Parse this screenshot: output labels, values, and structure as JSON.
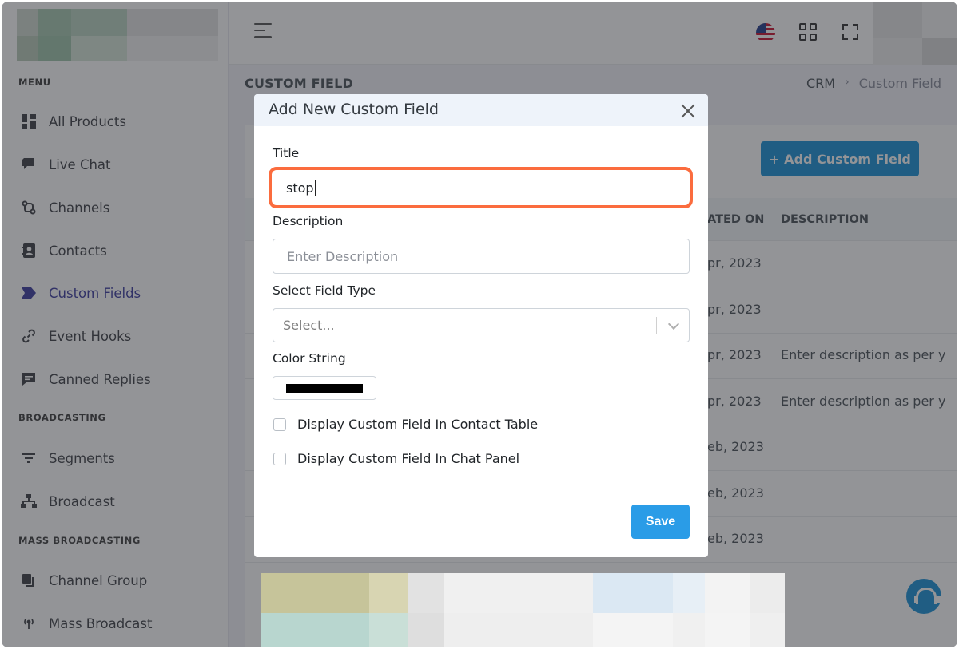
{
  "sidebar": {
    "headings": [
      "MENU",
      "BROADCASTING",
      "MASS BROADCASTING"
    ],
    "items": [
      {
        "label": "All Products",
        "icon": "dashboard-icon"
      },
      {
        "label": "Live Chat",
        "icon": "chat-icon"
      },
      {
        "label": "Channels",
        "icon": "channels-icon"
      },
      {
        "label": "Contacts",
        "icon": "contacts-icon"
      },
      {
        "label": "Custom Fields",
        "icon": "tag-icon"
      },
      {
        "label": "Event Hooks",
        "icon": "link-icon"
      },
      {
        "label": "Canned Replies",
        "icon": "message-icon"
      },
      {
        "label": "Segments",
        "icon": "filter-icon"
      },
      {
        "label": "Broadcast",
        "icon": "broadcast-icon"
      },
      {
        "label": "Channel Group",
        "icon": "copy-icon"
      },
      {
        "label": "Mass Broadcast",
        "icon": "antenna-icon"
      }
    ],
    "active_item": "Custom Fields"
  },
  "page": {
    "title": "CUSTOM FIELD",
    "breadcrumb": [
      "CRM",
      "Custom Field"
    ],
    "add_button": "+ Add Custom Field"
  },
  "table": {
    "headers": [
      "ATED ON",
      "DESCRIPTION"
    ],
    "rows": [
      {
        "created": "pr, 2023",
        "description": ""
      },
      {
        "created": "pr, 2023",
        "description": ""
      },
      {
        "created": "pr, 2023",
        "description": "Enter description as per y"
      },
      {
        "created": "pr, 2023",
        "description": "Enter description as per y"
      },
      {
        "created": "eb, 2023",
        "description": ""
      },
      {
        "created": "eb, 2023",
        "description": ""
      },
      {
        "created": "eb, 2023",
        "description": ""
      }
    ]
  },
  "modal": {
    "title": "Add New Custom Field",
    "title_label": "Title",
    "title_value": "stop",
    "description_label": "Description",
    "description_placeholder": "Enter Description",
    "field_type_label": "Select Field Type",
    "field_type_placeholder": "Select...",
    "color_label": "Color String",
    "color_value": "#000000",
    "checkbox_contact_table": "Display Custom Field In Contact Table",
    "checkbox_chat_panel": "Display Custom Field In Chat Panel",
    "save_label": "Save"
  },
  "colors": {
    "primary": "#1890d6",
    "highlight": "#fb6c3e",
    "active_nav": "#3b3b9e"
  }
}
